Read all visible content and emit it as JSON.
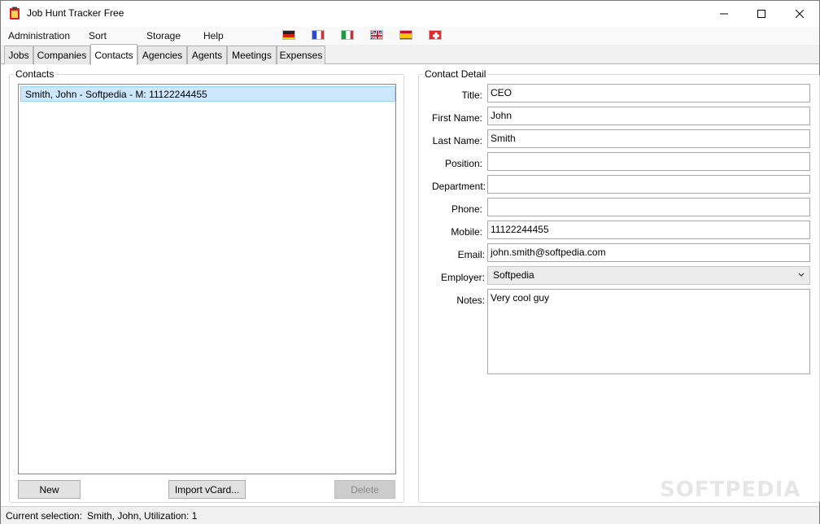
{
  "window": {
    "title": "Job Hunt Tracker Free",
    "icon": "clipboard-icon"
  },
  "menu": {
    "items": [
      "Administration",
      "Sort",
      "Storage",
      "Help"
    ],
    "flags": [
      "german-flag-icon",
      "french-flag-icon",
      "italian-flag-icon",
      "british-flag-icon",
      "spanish-flag-icon",
      "swiss-flag-icon"
    ]
  },
  "tabs": [
    "Jobs",
    "Companies",
    "Contacts",
    "Agencies",
    "Agents",
    "Meetings",
    "Expenses"
  ],
  "active_tab": "Contacts",
  "contacts": {
    "title": "Contacts",
    "items": [
      "Smith, John - Softpedia - M: 11122244455"
    ],
    "selected_index": 0,
    "new_label": "New",
    "import_label": "Import vCard...",
    "delete_label": "Delete"
  },
  "detail": {
    "title": "Contact Detail",
    "fields": [
      {
        "label": "Title:",
        "value": "CEO"
      },
      {
        "label": "First Name:",
        "value": "John"
      },
      {
        "label": "Last Name:",
        "value": "Smith"
      },
      {
        "label": "Position:",
        "value": ""
      },
      {
        "label": "Department:",
        "value": ""
      },
      {
        "label": "Phone:",
        "value": ""
      },
      {
        "label": "Mobile:",
        "value": "11122244455"
      },
      {
        "label": "Email:",
        "value": "john.smith@softpedia.com"
      }
    ],
    "employer": {
      "label": "Employer:",
      "value": "Softpedia"
    },
    "notes": {
      "label": "Notes:",
      "value": "Very cool guy"
    }
  },
  "status": {
    "label": "Current selection:",
    "value": "Smith, John, Utilization: 1"
  },
  "watermark": "SOFTPEDIA",
  "colors": {
    "selection": "#cce8ff",
    "selection_border": "#99d1ff",
    "icon_red": "#d9202a"
  }
}
